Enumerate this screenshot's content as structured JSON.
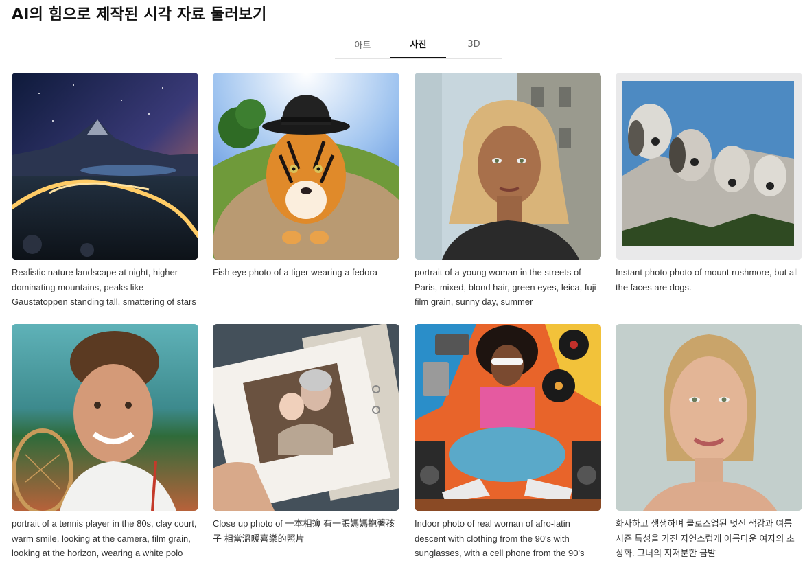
{
  "header": {
    "title": "AI의 힘으로 제작된 시각 자료 둘러보기"
  },
  "tabs": [
    {
      "label": "아트",
      "active": false
    },
    {
      "label": "사진",
      "active": true
    },
    {
      "label": "3D",
      "active": false
    }
  ],
  "gallery": [
    {
      "subject": "night-mountain-landscape",
      "caption": "Realistic nature landscape at night, higher dominating mountains, peaks like Gaustatoppen standing tall, smattering of stars"
    },
    {
      "subject": "tiger-with-fedora",
      "caption": "Fish eye photo of a tiger wearing a fedora"
    },
    {
      "subject": "woman-paris-street",
      "caption": "portrait of a young woman in the streets of Paris, mixed, blond hair, green eyes, leica, fuji film grain, sunny day, summer"
    },
    {
      "subject": "mount-rushmore-dogs",
      "caption": "Instant photo photo of mount rushmore, but all the faces are dogs."
    },
    {
      "subject": "tennis-player",
      "caption": "portrait of a tennis player in the 80s, clay court, warm smile, looking at the camera, film grain, looking at the horizon, wearing a white polo"
    },
    {
      "subject": "photo-album",
      "caption": "Close up photo of 一本相簿 有一張媽媽抱著孩子 相當溫暖喜樂的照片"
    },
    {
      "subject": "afro-latin-90s-woman",
      "caption": "Indoor photo of real woman of afro-latin descent with clothing from the 90's with sunglasses, with a cell phone from the 90's"
    },
    {
      "subject": "woman-portrait",
      "caption": "화사하고 생생하며 클로즈업된 멋진 색감과 여름 시즌 특성을 가진 자연스럽게 아름다운 여자의 초상화. 그녀의 지저분한 금발"
    }
  ]
}
